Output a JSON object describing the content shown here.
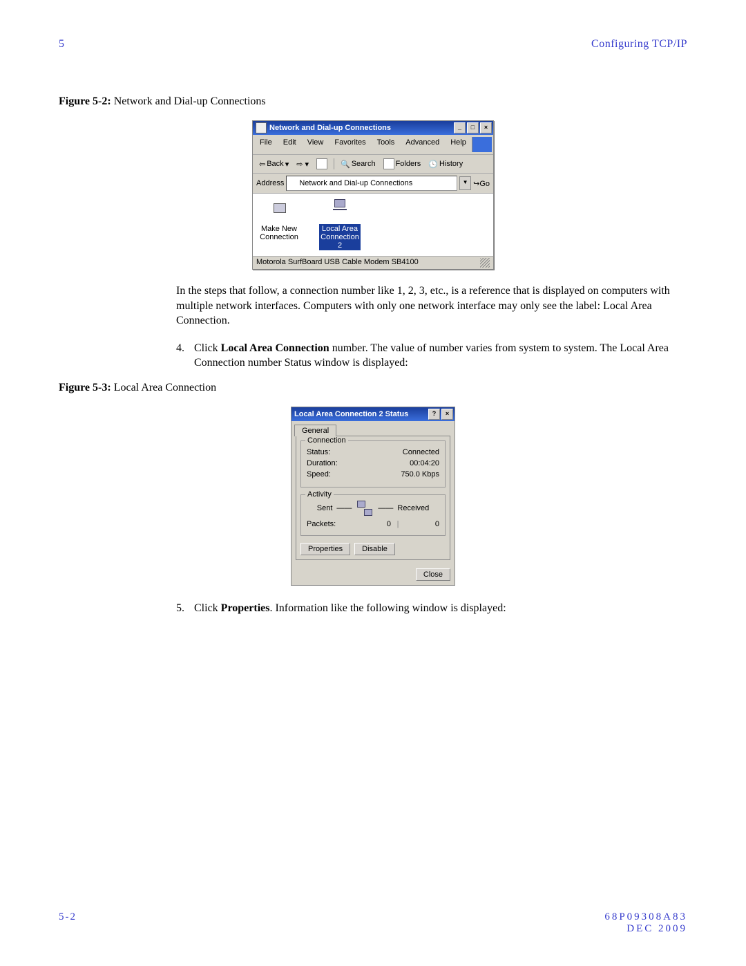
{
  "header": {
    "chapter": "5",
    "section": "Configuring TCP/IP"
  },
  "fig52": {
    "caption_label": "Figure 5-2:",
    "caption_text": " Network and Dial-up Connections"
  },
  "win1": {
    "title": "Network and Dial-up Connections",
    "menu": [
      "File",
      "Edit",
      "View",
      "Favorites",
      "Tools",
      "Advanced",
      "Help"
    ],
    "toolbar": {
      "back": "Back",
      "search": "Search",
      "folders": "Folders",
      "history": "History"
    },
    "address_label": "Address",
    "address_value": "Network and Dial-up Connections",
    "go": "Go",
    "icons": {
      "make_new": "Make New Connection",
      "lac": "Local Area Connection 2"
    },
    "status": "Motorola SurfBoard USB Cable Modem SB4100"
  },
  "para1": "In the steps that follow, a connection number like 1, 2, 3, etc., is a reference that is displayed on computers with multiple network interfaces. Computers with only one network interface may only see the label: Local Area Connection.",
  "step4": {
    "num": "4.",
    "pre": "Click ",
    "bold": "Local Area Connection",
    "post": " number. The value of number varies from system to system. The Local Area Connection number Status window is displayed:"
  },
  "fig53": {
    "caption_label": "Figure 5-3:",
    "caption_text": " Local Area Connection"
  },
  "dlg": {
    "title": "Local Area Connection 2 Status",
    "tab": "General",
    "grp_conn": "Connection",
    "status_l": "Status:",
    "status_v": "Connected",
    "dur_l": "Duration:",
    "dur_v": "00:04:20",
    "speed_l": "Speed:",
    "speed_v": "750.0 Kbps",
    "grp_act": "Activity",
    "sent": "Sent",
    "received": "Received",
    "packets_l": "Packets:",
    "sent_v": "0",
    "recv_v": "0",
    "properties": "Properties",
    "disable": "Disable",
    "close": "Close"
  },
  "step5": {
    "num": "5.",
    "pre": "Click ",
    "bold": "Properties",
    "post": ". Information like the following window is displayed:"
  },
  "footer": {
    "page": "5-2",
    "doc": "68P09308A83",
    "date": "DEC 2009"
  }
}
